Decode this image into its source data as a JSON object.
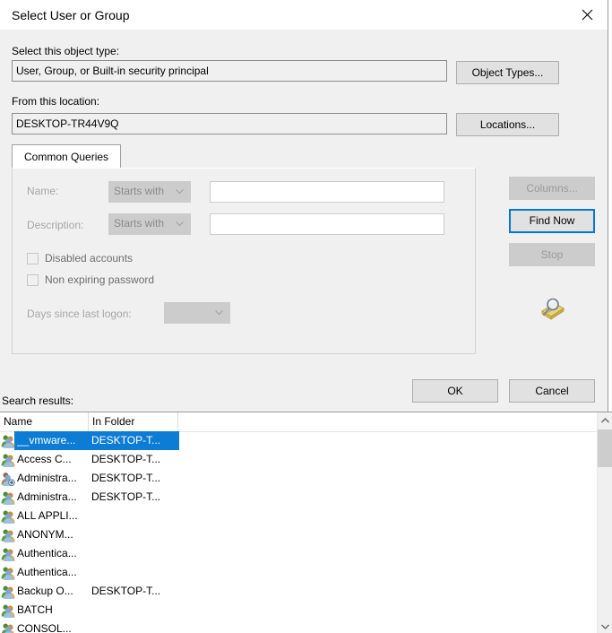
{
  "window": {
    "title": "Select User or Group",
    "close_icon": "close-icon"
  },
  "object_type": {
    "label": "Select this object type:",
    "value": "User, Group, or Built-in security principal",
    "button": "Object Types..."
  },
  "location": {
    "label": "From this location:",
    "value": "DESKTOP-TR44V9Q",
    "button": "Locations..."
  },
  "tabs": [
    {
      "label": "Common Queries",
      "active": true
    }
  ],
  "common_queries": {
    "name": {
      "label": "Name:",
      "operator": "Starts with",
      "value": "",
      "placeholder": ""
    },
    "description": {
      "label": "Description:",
      "operator": "Starts with",
      "value": "",
      "placeholder": ""
    },
    "disabled_accounts": {
      "label": "Disabled accounts",
      "checked": false
    },
    "non_expiring_password": {
      "label": "Non expiring password",
      "checked": false
    },
    "days_since_last_logon": {
      "label": "Days since last logon:",
      "value": ""
    }
  },
  "side_buttons": {
    "columns": {
      "label": "Columns...",
      "enabled": false
    },
    "find_now": {
      "label": "Find Now",
      "enabled": true,
      "default": true
    },
    "stop": {
      "label": "Stop",
      "enabled": false
    },
    "search_icon": "find-magnifier-icon"
  },
  "dialog_buttons": {
    "ok": "OK",
    "cancel": "Cancel"
  },
  "search_results": {
    "label": "Search results:",
    "columns": [
      "Name",
      "In Folder"
    ],
    "rows": [
      {
        "icon": "group-icon",
        "name": "__vmware...",
        "folder": "DESKTOP-T...",
        "selected": true
      },
      {
        "icon": "group-icon",
        "name": "Access C...",
        "folder": "DESKTOP-T...",
        "selected": false
      },
      {
        "icon": "user-icon",
        "name": "Administra...",
        "folder": "DESKTOP-T...",
        "selected": false
      },
      {
        "icon": "group-icon",
        "name": "Administra...",
        "folder": "DESKTOP-T...",
        "selected": false
      },
      {
        "icon": "group-icon",
        "name": "ALL APPLI...",
        "folder": "",
        "selected": false
      },
      {
        "icon": "group-icon",
        "name": "ANONYM...",
        "folder": "",
        "selected": false
      },
      {
        "icon": "group-icon",
        "name": "Authentica...",
        "folder": "",
        "selected": false
      },
      {
        "icon": "group-icon",
        "name": "Authentica...",
        "folder": "",
        "selected": false
      },
      {
        "icon": "group-icon",
        "name": "Backup O...",
        "folder": "DESKTOP-T...",
        "selected": false
      },
      {
        "icon": "group-icon",
        "name": "BATCH",
        "folder": "",
        "selected": false
      },
      {
        "icon": "group-icon",
        "name": "CONSOL...",
        "folder": "",
        "selected": false
      }
    ],
    "scrollbar": {
      "up": "scroll-up-arrow",
      "down": "scroll-down-arrow"
    }
  },
  "colors": {
    "dialog_bg": "#f0f0f0",
    "selection": "#0c7cd5",
    "default_button_focus": "#0078d7",
    "disabled_text": "#9a9a9a"
  }
}
